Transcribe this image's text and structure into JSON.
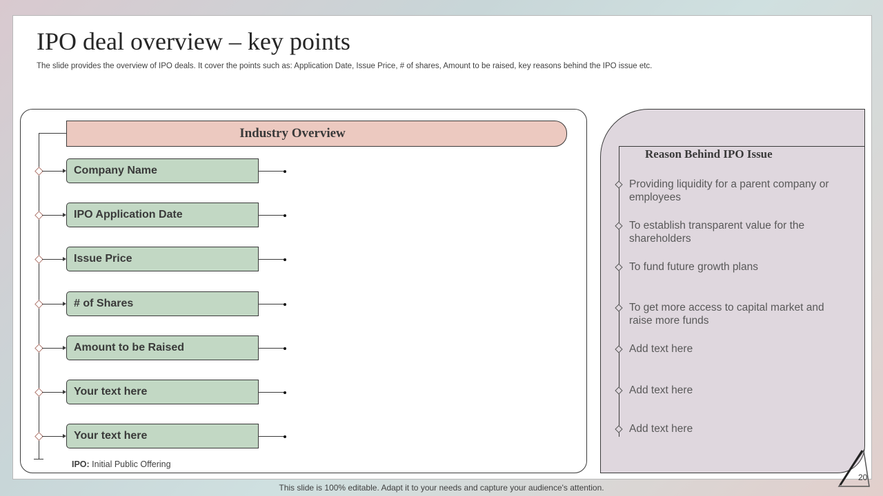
{
  "slide": {
    "title": "IPO deal overview – key points",
    "subtitle": "The slide provides the overview of IPO deals. It cover the points such as: Application Date, Issue Price, # of shares, Amount to be raised, key reasons behind the IPO issue etc.",
    "page_number": "20",
    "bottom_note": "This slide is 100% editable. Adapt it to your needs and capture your audience's attention."
  },
  "left_panel": {
    "header": "Industry  Overview",
    "items": [
      {
        "label": "Company Name"
      },
      {
        "label": "IPO Application Date"
      },
      {
        "label": "Issue Price"
      },
      {
        "label": "# of Shares"
      },
      {
        "label": "Amount to be Raised"
      },
      {
        "label": "Your text here"
      },
      {
        "label": "Your text here"
      }
    ],
    "footnote_term": "IPO:",
    "footnote_text": " Initial Public Offering"
  },
  "right_panel": {
    "title": "Reason Behind IPO Issue",
    "reasons": [
      "Providing liquidity for a parent company or employees",
      "To establish transparent value for the shareholders",
      "To fund future growth plans",
      "To get more access to capital market and raise more funds",
      "Add text here",
      "Add text here",
      "Add text here"
    ]
  },
  "colors": {
    "header_fill": "#ecc9c0",
    "item_fill": "#c2d8c4",
    "right_panel_fill": "#dfd7de",
    "outline": "#3a3a3a"
  }
}
